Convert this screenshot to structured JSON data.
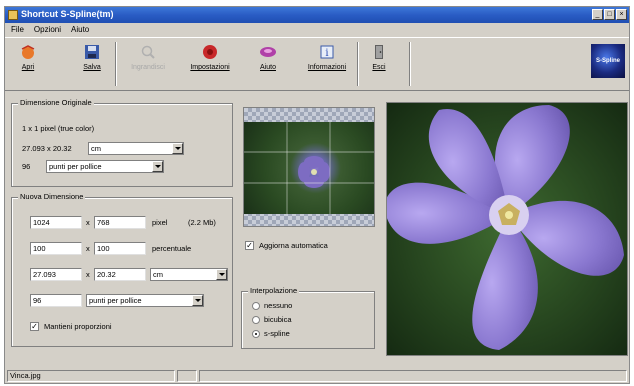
{
  "window": {
    "title": "Shortcut S-Spline(tm)"
  },
  "menu": [
    "File",
    "Opzioni",
    "Aiuto"
  ],
  "toolbar": {
    "open": "Apri",
    "save": "Salva",
    "zoom": "Ingrandisci",
    "settings": "Impostazioni",
    "help": "Aiuto",
    "info": "Informazioni",
    "exit": "Esci",
    "logo_text": "S-Spline"
  },
  "original": {
    "group_title": "Dimensione Originale",
    "pixel_info": "1 x 1 pixel (true color)",
    "size_value": "27.093 x 20.32",
    "size_unit": "cm",
    "res_value": "96",
    "res_unit": "punti per pollice"
  },
  "new_size": {
    "group_title": "Nuova Dimensione",
    "width_px": "1024",
    "height_px": "768",
    "px_label": "pixel",
    "mb_label": "(2.2 Mb)",
    "width_pct": "100",
    "height_pct": "100",
    "pct_label": "percentuale",
    "width_cm": "27.093",
    "height_cm": "20.32",
    "cm_unit": "cm",
    "res_value": "96",
    "res_unit": "punti per pollice",
    "x_sep": "x",
    "keep_ratio": "Mantieni proporzioni"
  },
  "auto_update": "Aggiorna automatica",
  "interpolation": {
    "title": "Interpolazione",
    "options": [
      "nessuno",
      "bicubica",
      "s-spline"
    ],
    "selected": 2
  },
  "status": {
    "filename": "Vinca.jpg"
  }
}
